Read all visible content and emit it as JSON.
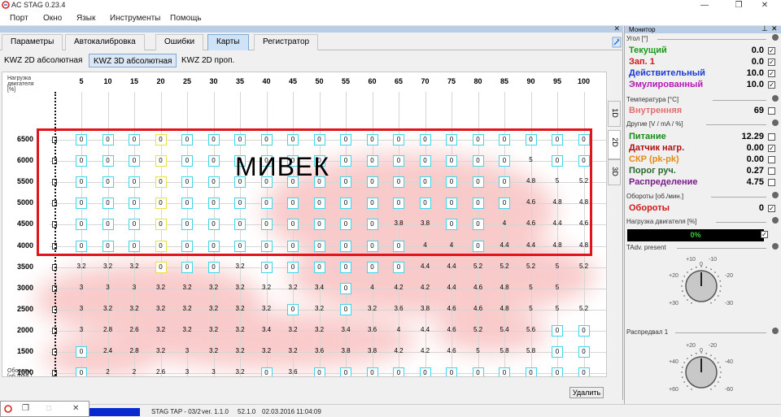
{
  "window": {
    "title": "AC STAG 0.23.4"
  },
  "menu": [
    "Порт",
    "Окно",
    "Язык",
    "Инструменты",
    "Помощь"
  ],
  "tabs_main": [
    {
      "label": "Параметры",
      "active": false
    },
    {
      "label": "Автокалибровка",
      "active": false
    },
    {
      "label": "Ошибки",
      "active": false
    },
    {
      "label": "Карты",
      "active": true
    },
    {
      "label": "Регистратор",
      "active": false
    }
  ],
  "tabs_map": [
    {
      "label": "KWZ 2D абсолютная",
      "active": false
    },
    {
      "label": "KWZ 3D абсолютная",
      "active": true
    },
    {
      "label": "KWZ 2D проп.",
      "active": false
    }
  ],
  "map": {
    "x_caption": "Нагрузка двигателя [%]",
    "y_caption": "Обороты [об./мин.]",
    "x_ticks": [
      5,
      10,
      15,
      20,
      25,
      30,
      35,
      40,
      45,
      50,
      55,
      60,
      65,
      70,
      75,
      80,
      85,
      90,
      95,
      100
    ],
    "y_ticks": [
      6500,
      6000,
      5500,
      5000,
      4500,
      4000,
      3500,
      3000,
      2500,
      2000,
      1500,
      1000,
      500
    ],
    "highlight_column": 20,
    "cells": [
      [
        "0",
        "0",
        "0",
        "0",
        "0",
        "0",
        "0",
        "0",
        "0",
        "0",
        "0",
        "0",
        "0",
        "0",
        "0",
        "0",
        "0",
        "0",
        "0",
        "0"
      ],
      [
        "0",
        "0",
        "0",
        "0",
        "0",
        "0",
        "0",
        "0",
        "0",
        "0",
        "0",
        "0",
        "0",
        "0",
        "0",
        "0",
        "0",
        "5",
        "0",
        "0"
      ],
      [
        "0",
        "0",
        "0",
        "0",
        "0",
        "0",
        "0",
        "0",
        "0",
        "0",
        "0",
        "0",
        "0",
        "0",
        "0",
        "0",
        "0",
        "4.8",
        "5",
        "5.2"
      ],
      [
        "0",
        "0",
        "0",
        "0",
        "0",
        "0",
        "0",
        "0",
        "0",
        "0",
        "0",
        "0",
        "0",
        "0",
        "0",
        "0",
        "0",
        "4.6",
        "4.8",
        "4.8"
      ],
      [
        "0",
        "0",
        "0",
        "0",
        "0",
        "0",
        "0",
        "0",
        "0",
        "0",
        "0",
        "0",
        "3.8",
        "3.8",
        "0",
        "0",
        "4",
        "4.6",
        "4.4",
        "4.6"
      ],
      [
        "0",
        "0",
        "0",
        "0",
        "0",
        "0",
        "0",
        "0",
        "0",
        "0",
        "0",
        "0",
        "0",
        "4",
        "4",
        "0",
        "4.4",
        "4.4",
        "4.8",
        "4.8"
      ],
      [
        "3.2",
        "3.2",
        "3.2",
        "0",
        "0",
        "0",
        "3.2",
        "0",
        "0",
        "0",
        "0",
        "0",
        "0",
        "4.4",
        "4.4",
        "5.2",
        "5.2",
        "5.2",
        "5",
        "5.2"
      ],
      [
        "3",
        "3",
        "3",
        "3.2",
        "3.2",
        "3.2",
        "3.2",
        "3.2",
        "3.2",
        "3.4",
        "0",
        "4",
        "4.2",
        "4.2",
        "4.4",
        "4.6",
        "4.8",
        "5",
        "5"
      ],
      [
        "3",
        "3.2",
        "3.2",
        "3.2",
        "3.2",
        "3.2",
        "3.2",
        "3.2",
        "0",
        "3.2",
        "0",
        "3.2",
        "3.6",
        "3.8",
        "4.6",
        "4.6",
        "4.8",
        "5",
        "5",
        "5.2"
      ],
      [
        "3",
        "2.8",
        "2.6",
        "3.2",
        "3.2",
        "3.2",
        "3.2",
        "3.4",
        "3.2",
        "3.2",
        "3.4",
        "3.6",
        "4",
        "4.4",
        "4.6",
        "5.2",
        "5.4",
        "5.6",
        "0",
        "0"
      ],
      [
        "0",
        "2.4",
        "2.8",
        "3.2",
        "3",
        "3.2",
        "3.2",
        "3.2",
        "3.2",
        "3.6",
        "3.8",
        "3.8",
        "4.2",
        "4.2",
        "4.6",
        "5",
        "5.8",
        "5.8",
        "0",
        "0"
      ],
      [
        "0",
        "2",
        "2",
        "2.6",
        "3",
        "3",
        "3.2",
        "0",
        "3.6",
        "0",
        "0",
        "0",
        "0",
        "0",
        "0",
        "0",
        "0",
        "0",
        "0",
        "0"
      ],
      [
        "0",
        "1.6",
        "2",
        "2.2",
        "2.2",
        "2.2",
        "2.6",
        "0",
        "0",
        "0",
        "0",
        "0",
        "0",
        "0",
        "0",
        "0",
        "0",
        "0",
        "0",
        "0"
      ]
    ],
    "stamp_text": "МИВЕК",
    "vtabs": [
      "1D",
      "2D",
      "3D"
    ],
    "delete_label": "Удалить"
  },
  "status": {
    "device": "STAG TAP - 03/2",
    "version": "ver. 1.1.0",
    "build": "52.1.0",
    "datetime": "02.03.2016 11:04:09"
  },
  "monitor": {
    "title": "Монитор",
    "angle_title": "Угол [°]",
    "angle_rows": [
      {
        "label": "Текущий",
        "value": "0.0",
        "color": "#1a9a1a",
        "checked": true
      },
      {
        "label": "Зап. 1",
        "value": "0.0",
        "color": "#d01818",
        "checked": true
      },
      {
        "label": "Действительный",
        "value": "10.0",
        "color": "#1a3ad4",
        "checked": true
      },
      {
        "label": "Эмулированный",
        "value": "10.0",
        "color": "#b21ab2",
        "checked": true
      }
    ],
    "temp_title": "Температура [°С]",
    "temp_rows": [
      {
        "label": "Внутренняя",
        "value": "69",
        "color": "#e07070",
        "checked": false
      }
    ],
    "other_title": "Другие [V / mA / %]",
    "other_rows": [
      {
        "label": "Питание",
        "value": "12.29",
        "color": "#1a8a1a",
        "checked": false
      },
      {
        "label": "Датчик нагр.",
        "value": "0.00",
        "color": "#b01010",
        "checked": true
      },
      {
        "label": "СКР (pk-pk)",
        "value": "0.00",
        "color": "#e68a10",
        "checked": false
      },
      {
        "label": "Порог руч.",
        "value": "0.27",
        "color": "#2a6a2a",
        "checked": false
      },
      {
        "label": "Распределение",
        "value": "4.75",
        "color": "#7a1a8a",
        "checked": false
      }
    ],
    "rpm_title": "Обороты [об./мин.]",
    "rpm_rows": [
      {
        "label": "Обороты",
        "value": "0",
        "color": "#d01818",
        "checked": true
      }
    ],
    "load_title": "Нагрузка двигателя [%]",
    "load_value": "0%",
    "tadv_title": "TAdv. present",
    "tadv_labels": [
      "+10",
      "0",
      "-10",
      "+20",
      "-20",
      "+30",
      "-30"
    ],
    "cam_title": "Распредвал 1",
    "cam_labels": [
      "+20",
      "0",
      "-20",
      "+40",
      "-40",
      "+60",
      "-60"
    ]
  }
}
